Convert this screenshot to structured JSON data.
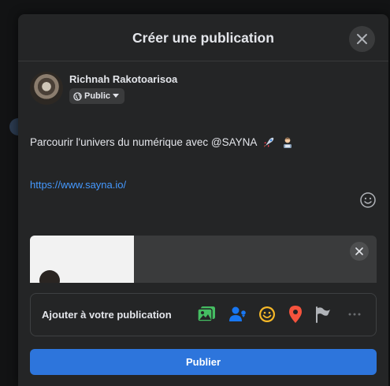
{
  "modal": {
    "title": "Créer une publication"
  },
  "author": {
    "name": "Richnah Rakotoarisoa",
    "privacy_label": "Public"
  },
  "post": {
    "text": "Parcourir l'univers du numérique avec @SAYNA",
    "link": "https://www.sayna.io/"
  },
  "add_to_post": {
    "label": "Ajouter à votre publication",
    "icons": [
      "photo-video-icon",
      "tag-people-icon",
      "feeling-icon",
      "location-pin-icon",
      "flag-icon",
      "more-icon"
    ]
  },
  "publish_button": {
    "label": "Publier"
  },
  "colors": {
    "modal_bg": "#242526",
    "accent_blue": "#2d75dc",
    "link_blue": "#4599ff",
    "photo_green": "#45bd62",
    "tag_blue": "#1877f2",
    "feeling_yellow": "#f7b928",
    "location_red": "#f5533d",
    "muted_grey": "#b0b3b8"
  }
}
